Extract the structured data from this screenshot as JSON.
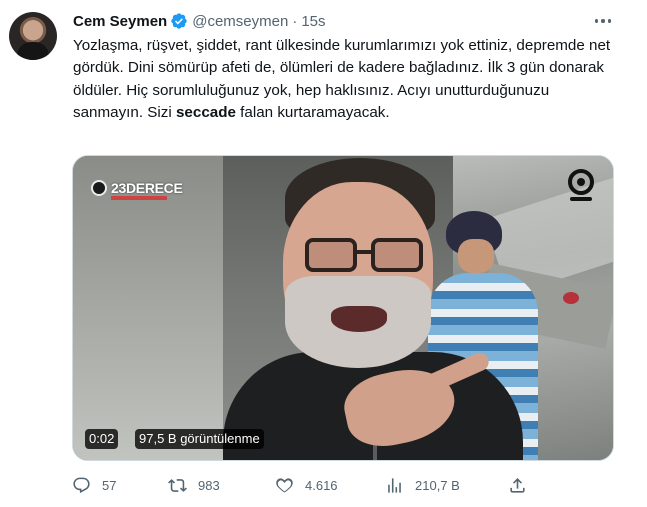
{
  "tweet": {
    "author_name": "Cem Seymen",
    "handle": "@cemseymen",
    "separator": "·",
    "time": "15s",
    "text_before_bold": "Yozlaşma, rüşvet, şiddet, rant ülkesinde kurumlarımızı yok ettiniz, depremde net gördük. Dini sömürüp afeti de, ölümleri de kadere bağladınız. İlk 3 gün donarak öldüler. Hiç sorumluluğunuz yok, hep haklısınız. Acıyı unutturduğunuzu sanmayın. Sizi ",
    "bold_word": "seccade",
    "text_after_bold": " falan kurtaramayacak."
  },
  "media": {
    "watermark": "23DERECE",
    "duration": "0:02",
    "views": "97,5 B görüntülenme"
  },
  "actions": {
    "replies": "57",
    "retweets": "983",
    "likes": "4.616",
    "views": "210,7 B"
  },
  "icons": {
    "verified": "verified-badge-icon",
    "more": "more-options-icon",
    "reply": "reply-icon",
    "retweet": "retweet-icon",
    "like": "heart-icon",
    "analytics": "analytics-icon",
    "share": "share-icon"
  },
  "colors": {
    "accent": "#1d9bf0",
    "text": "#0f1419",
    "muted": "#536471"
  }
}
